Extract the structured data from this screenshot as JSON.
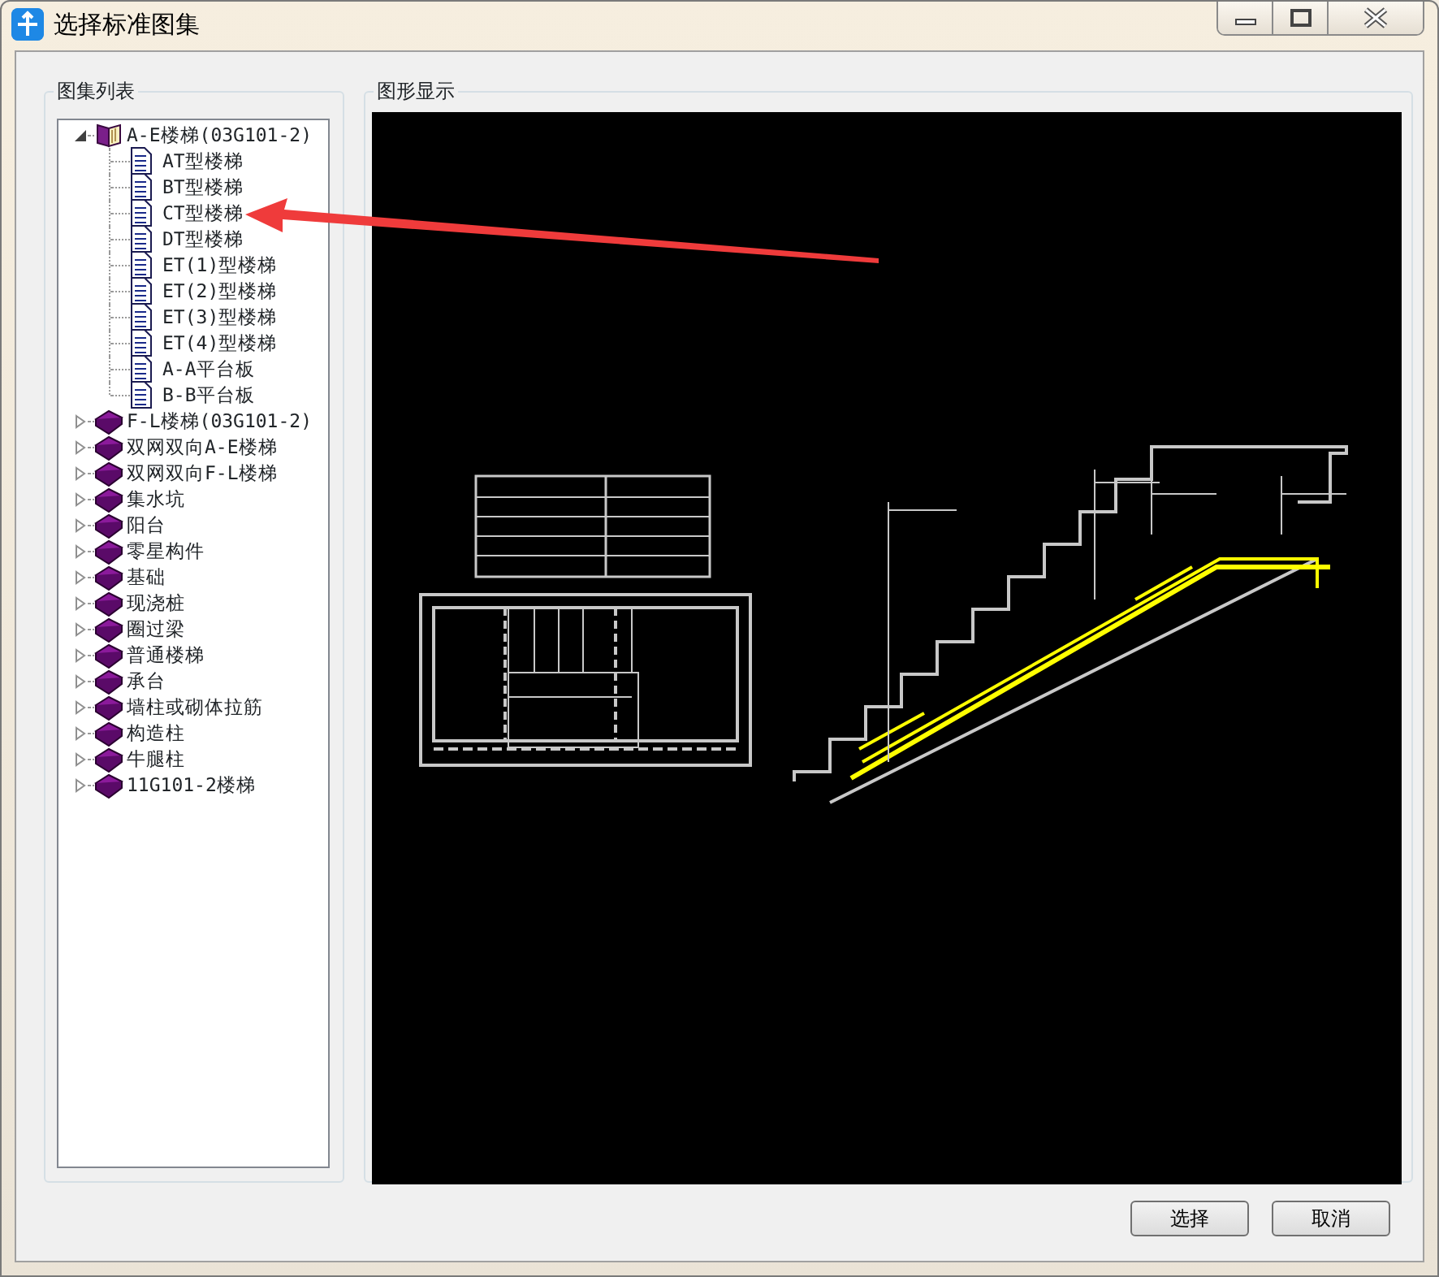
{
  "window": {
    "title": "选择标准图集"
  },
  "left_panel": {
    "title": "图集列表",
    "tree": [
      {
        "label": "A-E楼梯(03G101-2)",
        "expanded": true,
        "children": [
          {
            "label": "AT型楼梯"
          },
          {
            "label": "BT型楼梯"
          },
          {
            "label": "CT型楼梯"
          },
          {
            "label": "DT型楼梯"
          },
          {
            "label": "ET(1)型楼梯"
          },
          {
            "label": "ET(2)型楼梯"
          },
          {
            "label": "ET(3)型楼梯"
          },
          {
            "label": "ET(4)型楼梯"
          },
          {
            "label": "A-A平台板"
          },
          {
            "label": "B-B平台板"
          }
        ]
      },
      {
        "label": "F-L楼梯(03G101-2)",
        "expanded": false
      },
      {
        "label": "双网双向A-E楼梯",
        "expanded": false
      },
      {
        "label": "双网双向F-L楼梯",
        "expanded": false
      },
      {
        "label": "集水坑",
        "expanded": false
      },
      {
        "label": "阳台",
        "expanded": false
      },
      {
        "label": "零星构件",
        "expanded": false
      },
      {
        "label": "基础",
        "expanded": false
      },
      {
        "label": "现浇桩",
        "expanded": false
      },
      {
        "label": "圈过梁",
        "expanded": false
      },
      {
        "label": "普通楼梯",
        "expanded": false
      },
      {
        "label": "承台",
        "expanded": false
      },
      {
        "label": "墙柱或砌体拉筋",
        "expanded": false
      },
      {
        "label": "构造柱",
        "expanded": false
      },
      {
        "label": "牛腿柱",
        "expanded": false
      },
      {
        "label": "11G101-2楼梯",
        "expanded": false
      }
    ]
  },
  "right_panel": {
    "title": "图形显示"
  },
  "buttons": [
    "选择",
    "取消"
  ]
}
